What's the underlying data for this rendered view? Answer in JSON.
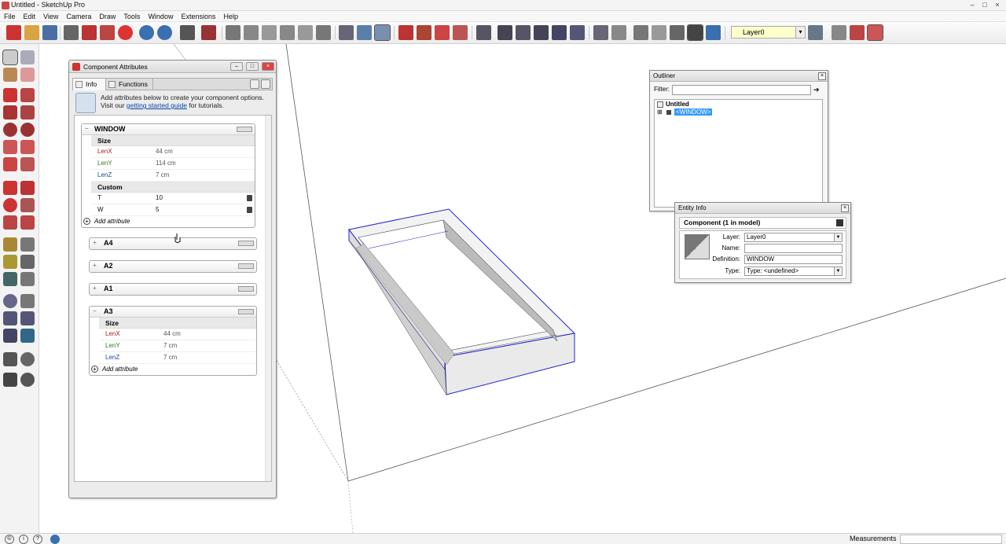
{
  "window": {
    "title": "Untitled - SketchUp Pro",
    "min": "–",
    "max": "□",
    "close": "×"
  },
  "menu": [
    "File",
    "Edit",
    "View",
    "Camera",
    "Draw",
    "Tools",
    "Window",
    "Extensions",
    "Help"
  ],
  "toolbar": {
    "layer_value": "Layer0",
    "layer_arrow": "▾"
  },
  "colors": {
    "accent": "#3399ff",
    "attr_red": "#a22",
    "attr_green": "#3a7a1f",
    "attr_blue": "#1f4b9a",
    "selection": "#2222cc"
  },
  "component_attributes": {
    "title": "Component Attributes",
    "tabs": {
      "info": "Info",
      "functions": "Functions"
    },
    "info_text_1": "Add attributes below to create your component options. Visit our ",
    "info_link": "getting started guide",
    "info_text_2": " for tutorials.",
    "window": {
      "name": "WINDOW",
      "toggle": "−",
      "size_label": "Size",
      "size_rows": [
        {
          "k": "LenX",
          "v": "44 cm"
        },
        {
          "k": "LenY",
          "v": "114 cm"
        },
        {
          "k": "LenZ",
          "v": "7 cm"
        }
      ],
      "custom_label": "Custom",
      "custom_rows": [
        {
          "k": "T",
          "v": "10"
        },
        {
          "k": "W",
          "v": "5"
        }
      ],
      "add_attribute": "Add attribute"
    },
    "collapsed": [
      {
        "name": "A4",
        "toggle": "+"
      },
      {
        "name": "A2",
        "toggle": "+"
      },
      {
        "name": "A1",
        "toggle": "+"
      }
    ],
    "a3": {
      "name": "A3",
      "toggle": "−",
      "size_label": "Size",
      "size_rows": [
        {
          "k": "LenX",
          "v": "44 cm"
        },
        {
          "k": "LenY",
          "v": "7 cm"
        },
        {
          "k": "LenZ",
          "v": "7 cm"
        }
      ],
      "add_attribute": "Add attribute"
    }
  },
  "outliner": {
    "title": "Outliner",
    "filter_label": "Filter:",
    "root": "Untitled",
    "child": "<WINDOW>",
    "expander": "⊞",
    "go": "➔"
  },
  "entity_info": {
    "title": "Entity Info",
    "header": "Component (1 in model)",
    "layer_label": "Layer:",
    "layer_value": "Layer0",
    "name_label": "Name:",
    "name_value": "",
    "definition_label": "Definition:",
    "definition_value": "WINDOW",
    "type_label": "Type:",
    "type_value": "Type: <undefined>"
  },
  "status": {
    "measurements": "Measurements",
    "icon_info": "i",
    "icon_help": "?",
    "icon_geo": "©"
  }
}
